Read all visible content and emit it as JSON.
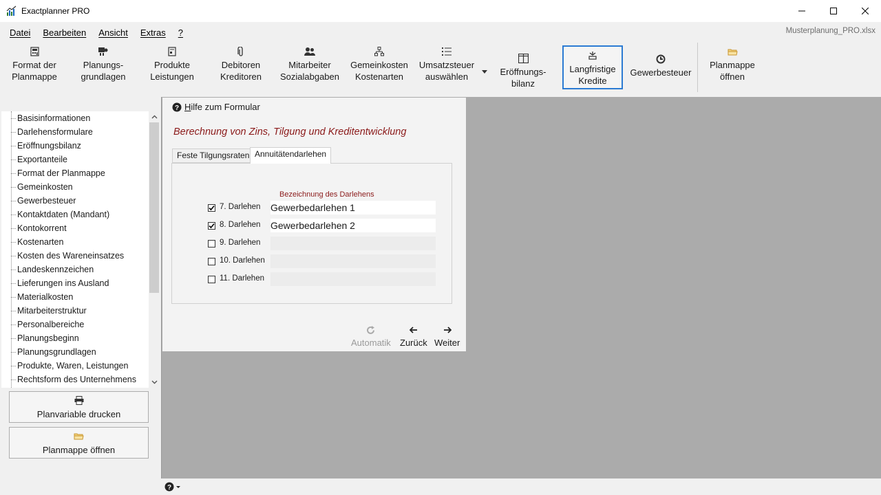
{
  "window": {
    "title": "Exactplanner PRO",
    "filename": "Musterplanung_PRO.xlsx",
    "minimize_icon": "minimize-icon",
    "maximize_icon": "maximize-icon",
    "close_icon": "close-icon"
  },
  "menu": {
    "items": [
      "Datei",
      "Bearbeiten",
      "Ansicht",
      "Extras",
      "?"
    ]
  },
  "ribbon": {
    "buttons": [
      {
        "label": "Format der\nPlanmappe",
        "icon": "calculator-icon"
      },
      {
        "label": "Planungs-\ngrundlagen",
        "icon": "planning-icon"
      },
      {
        "label": "Produkte\nLeistungen",
        "icon": "product-icon"
      },
      {
        "label": "Debitoren\nKreditoren",
        "icon": "paperclip-icon"
      },
      {
        "label": "Mitarbeiter\nSozialabgaben",
        "icon": "employees-icon"
      },
      {
        "label": "Gemeinkosten\nKostenarten",
        "icon": "hierarchy-icon"
      },
      {
        "label": "Umsatzsteuer\nauswählen",
        "icon": "list-icon"
      },
      {
        "label": "Eröffnungs-\nbilanz",
        "icon": "balance-icon"
      },
      {
        "label": "Langfristige\nKredite",
        "icon": "bank-icon",
        "active": true
      },
      {
        "label": "Gewerbesteuer",
        "icon": "tax-icon"
      },
      {
        "label": "Planmappe\nöffnen",
        "icon": "folder-icon"
      }
    ]
  },
  "tree": {
    "items": [
      "Basisinformationen",
      "Darlehensformulare",
      "Eröffnungsbilanz",
      "Exportanteile",
      "Format der Planmappe",
      "Gemeinkosten",
      "Gewerbesteuer",
      "Kontaktdaten (Mandant)",
      "Kontokorrent",
      "Kostenarten",
      "Kosten des Wareneinsatzes",
      "Landeskennzeichen",
      "Lieferungen ins Ausland",
      "Materialkosten",
      "Mitarbeiterstruktur",
      "Personalbereiche",
      "Planungsbeginn",
      "Planungsgrundlagen",
      "Produkte, Waren, Leistungen",
      "Rechtsform des Unternehmens"
    ]
  },
  "sidebar_buttons": {
    "print_label": "Planvariable drucken",
    "open_label": "Planmappe öffnen"
  },
  "form": {
    "help_label": "Hilfe zum Formular",
    "title": "Berechnung von Zins, Tilgung und Kreditentwicklung",
    "tabs": [
      "Feste Tilgungsraten",
      "Annuitätendarlehen"
    ],
    "active_tab": "Annuitätendarlehen",
    "column_header": "Bezeichnung des Darlehens",
    "loans": [
      {
        "label": "7. Darlehen",
        "checked": true,
        "value": "Gewerbedarlehen 1"
      },
      {
        "label": "8. Darlehen",
        "checked": true,
        "value": "Gewerbedarlehen 2"
      },
      {
        "label": "9. Darlehen",
        "checked": false,
        "value": ""
      },
      {
        "label": "10. Darlehen",
        "checked": false,
        "value": ""
      },
      {
        "label": "11. Darlehen",
        "checked": false,
        "value": ""
      }
    ],
    "nav": {
      "auto_label": "Automatik",
      "back_label": "Zurück",
      "next_label": "Weiter"
    }
  },
  "colors": {
    "accent_blue": "#2b7bd3",
    "title_red": "#8b1a1a",
    "workspace_gray": "#ababab"
  }
}
